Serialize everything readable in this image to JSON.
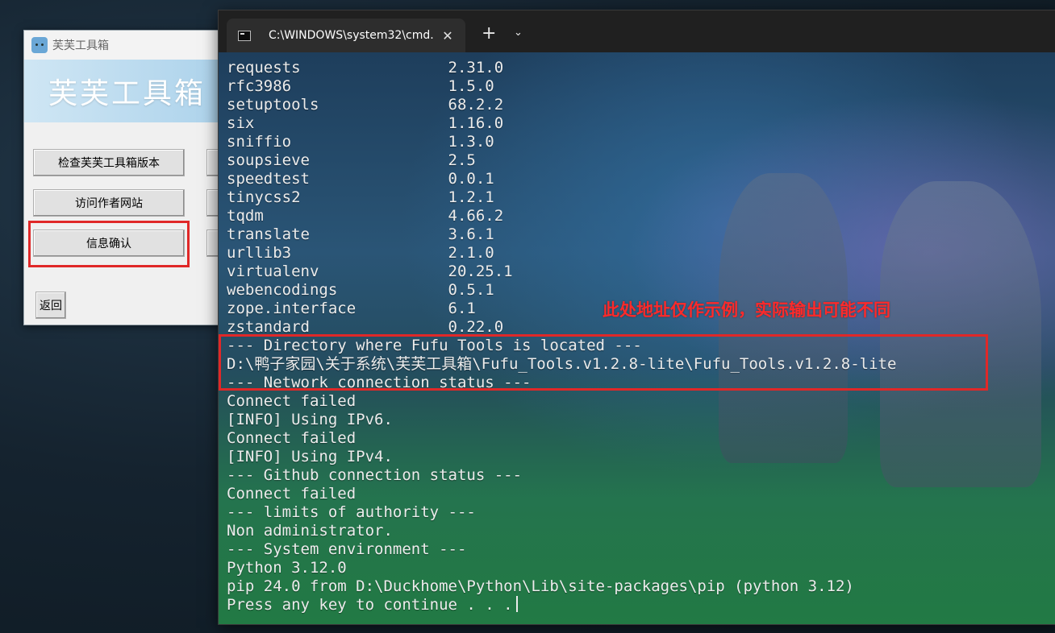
{
  "fufu_window": {
    "title": "芙芙工具箱",
    "banner_title": "芙芙工具箱",
    "buttons": {
      "check_version": "检查芙芙工具箱版本",
      "visit_author": "访问作者网站",
      "info_confirm": "信息确认",
      "back": "返回"
    }
  },
  "terminal": {
    "tab_title": "C:\\WINDOWS\\system32\\cmd.",
    "close_glyph": "✕",
    "new_tab_glyph": "+",
    "dropdown_glyph": "⌄",
    "annotation": "此处地址仅作示例，实际输出可能不同",
    "lines": [
      "requests                2.31.0",
      "rfc3986                 1.5.0",
      "setuptools              68.2.2",
      "six                     1.16.0",
      "sniffio                 1.3.0",
      "soupsieve               2.5",
      "speedtest               0.0.1",
      "tinycss2                1.2.1",
      "tqdm                    4.66.2",
      "translate               3.6.1",
      "urllib3                 2.1.0",
      "virtualenv              20.25.1",
      "webencodings            0.5.1",
      "zope.interface          6.1",
      "zstandard               0.22.0",
      "--- Directory where Fufu Tools is located ---",
      "D:\\鸭子家园\\关于系统\\芙芙工具箱\\Fufu_Tools.v1.2.8-lite\\Fufu_Tools.v1.2.8-lite",
      "--- Network connection status ---",
      "Connect failed",
      "[INFO] Using IPv6.",
      "Connect failed",
      "[INFO] Using IPv4.",
      "--- Github connection status ---",
      "Connect failed",
      "--- limits of authority ---",
      "Non administrator.",
      "--- System environment ---",
      "Python 3.12.0",
      "pip 24.0 from D:\\Duckhome\\Python\\Lib\\site-packages\\pip (python 3.12)",
      "Press any key to continue . . ."
    ]
  }
}
